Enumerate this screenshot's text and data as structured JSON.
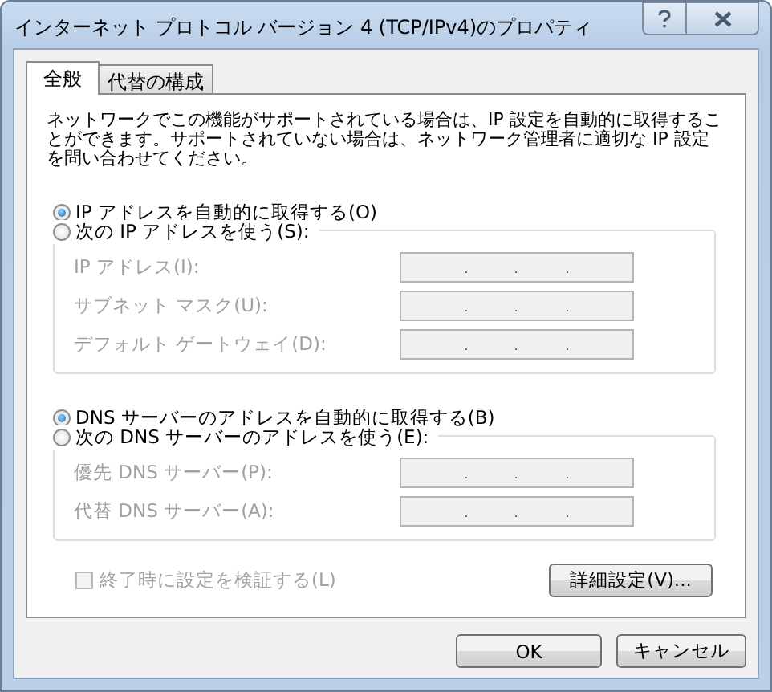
{
  "window": {
    "title": "インターネット プロトコル バージョン 4 (TCP/IPv4)のプロパティ"
  },
  "tabs": [
    {
      "label": "全般",
      "selected": true
    },
    {
      "label": "代替の構成",
      "selected": false
    }
  ],
  "description": "ネットワークでこの機能がサポートされている場合は、IP 設定を自動的に取得することができます。サポートされていない場合は、ネットワーク管理者に適切な IP 設定を問い合わせてください。",
  "ip_section": {
    "auto_option": {
      "label": "IP アドレスを自動的に取得する(O)",
      "selected": true
    },
    "manual_option": {
      "label": "次の IP アドレスを使う(S):",
      "selected": false
    },
    "fields": [
      {
        "label": "IP アドレス(I):",
        "disabled": true
      },
      {
        "label": "サブネット マスク(U):",
        "disabled": true
      },
      {
        "label": "デフォルト ゲートウェイ(D):",
        "disabled": true
      }
    ]
  },
  "dns_section": {
    "auto_option": {
      "label": "DNS サーバーのアドレスを自動的に取得する(B)",
      "selected": true
    },
    "manual_option": {
      "label": "次の DNS サーバーのアドレスを使う(E):",
      "selected": false
    },
    "fields": [
      {
        "label": "優先 DNS サーバー(P):",
        "disabled": true
      },
      {
        "label": "代替 DNS サーバー(A):",
        "disabled": true
      }
    ]
  },
  "validate_checkbox": {
    "label": "終了時に設定を検証する(L)",
    "checked": false,
    "disabled": true
  },
  "advanced_button": "詳細設定(V)...",
  "buttons": [
    "OK",
    "キャンセル"
  ]
}
